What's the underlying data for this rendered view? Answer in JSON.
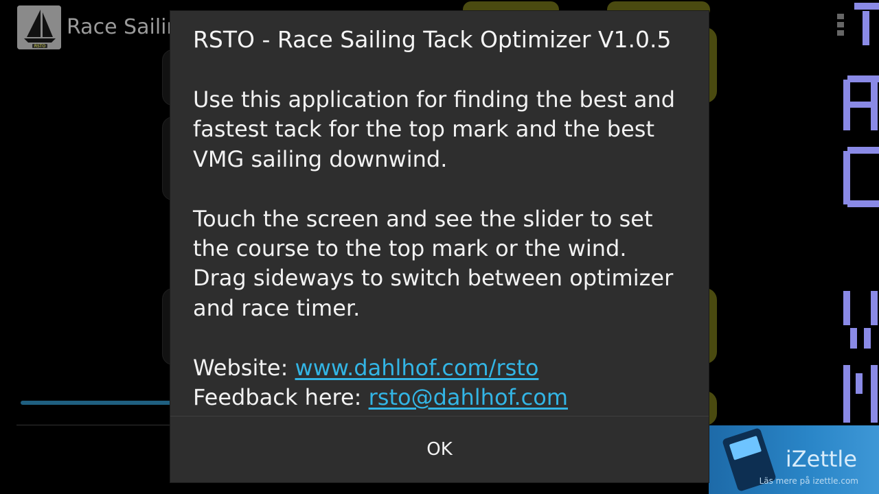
{
  "app": {
    "title": "Race Sailin",
    "logo_text": "RSTO",
    "icon": "sailboat-logo-icon"
  },
  "ad": {
    "brand": "iZettle",
    "subtext": "Läs mere på izettle.com",
    "colors": {
      "background": "#2a86c8"
    }
  },
  "dialog": {
    "title": "RSTO - Race Sailing Tack Optimizer V1.0.5",
    "paragraphs": [
      {
        "lines": [
          "Use this application for finding the best and",
          "fastest tack for the top mark and the best",
          "VMG sailing downwind."
        ]
      },
      {
        "lines": [
          "Touch the screen and see the slider to set",
          "the course to the top mark or the wind.",
          "Drag sideways to switch between optimizer",
          "and race timer."
        ]
      }
    ],
    "website_label": "Website: ",
    "website_link": "www.dahlhof.com/rsto",
    "feedback_label": "Feedback here: ",
    "feedback_link": "rsto@dahlhof.com",
    "ok_label": "OK"
  },
  "colors": {
    "dialog_background": "#2e2e2e",
    "link": "#33b5e5",
    "segment_display": "#8a8ae6",
    "tile_yellow": "#4a4a10"
  }
}
